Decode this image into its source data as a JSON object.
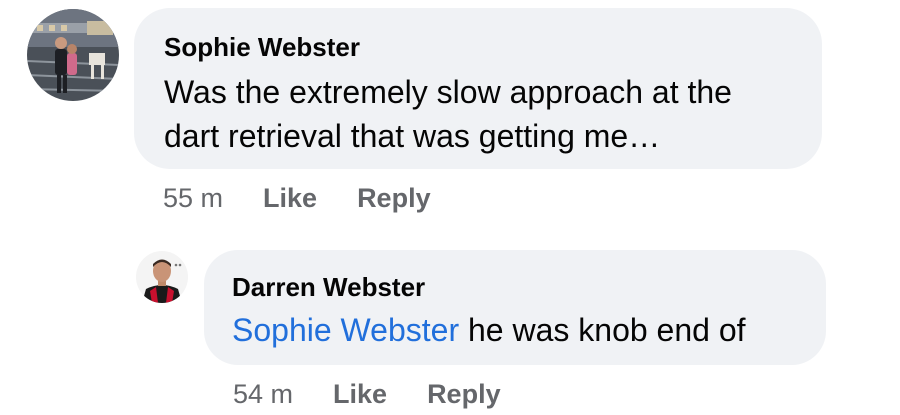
{
  "comments": [
    {
      "author": "Sophie Webster",
      "text_line1": "Was the extremely slow approach at the",
      "text_line2": "dart retrieval that was getting me…",
      "time": "55 m",
      "like_label": "Like",
      "reply_label": "Reply"
    }
  ],
  "replies": [
    {
      "author": "Darren Webster",
      "mention": "Sophie Webster",
      "text": " he was knob end of",
      "time": "54 m",
      "like_label": "Like",
      "reply_label": "Reply"
    }
  ],
  "colors": {
    "bubble": "#f0f2f5",
    "mention": "#216fdb",
    "meta": "#65676b",
    "text": "#050505"
  }
}
